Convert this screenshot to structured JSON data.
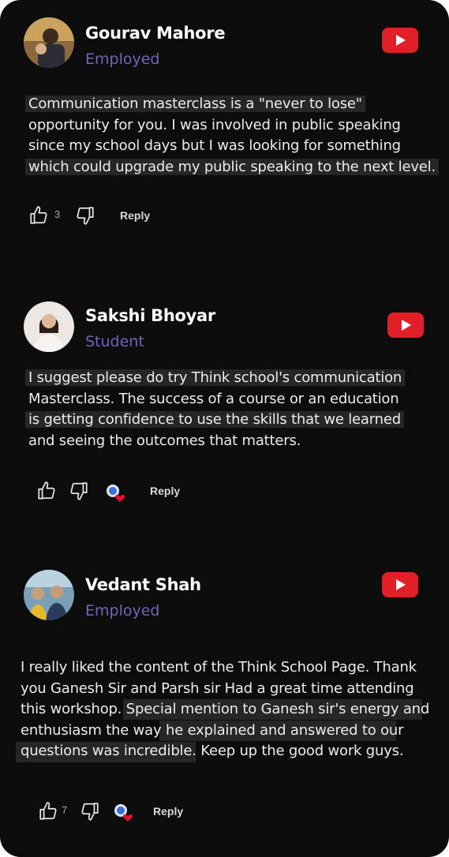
{
  "colors": {
    "background": "#0c0c0c",
    "role_text": "#6e66b8",
    "youtube_red": "#e01f26",
    "highlight": "#262626"
  },
  "comments": [
    {
      "name": "Gourav Mahore",
      "role": "Employed",
      "lines": [
        "Communication masterclass is a \"never to lose\"",
        "opportunity for you. I was involved in public speaking",
        "since my school days but I was looking for something",
        "which could upgrade my public speaking to the next level."
      ],
      "likes": "3",
      "reply_label": "Reply",
      "icons": [
        "youtube-icon",
        "thumb-up-icon",
        "thumb-down-icon"
      ]
    },
    {
      "name": "Sakshi Bhoyar",
      "role": "Student",
      "lines": [
        "I suggest please do try Think school's communication",
        "Masterclass. The success of a course or an education",
        "is getting confidence to use the skills that we learned",
        "and seeing the outcomes that matters."
      ],
      "likes": "",
      "reply_label": "Reply",
      "icons": [
        "youtube-icon",
        "thumb-up-icon",
        "thumb-down-icon",
        "creator-heart-icon"
      ]
    },
    {
      "name": "Vedant Shah",
      "role": "Employed",
      "lines": [
        "I really liked the content of the Think School Page. Thank",
        "you Ganesh Sir and Parsh sir  Had a great time attending",
        "this workshop. Special mention to Ganesh sir's energy and",
        "enthusiasm the way he explained and answered to our",
        "questions was incredible. Keep up the good work guys."
      ],
      "likes": "7",
      "reply_label": "Reply",
      "icons": [
        "youtube-icon",
        "thumb-up-icon",
        "thumb-down-icon",
        "creator-heart-icon"
      ]
    }
  ]
}
